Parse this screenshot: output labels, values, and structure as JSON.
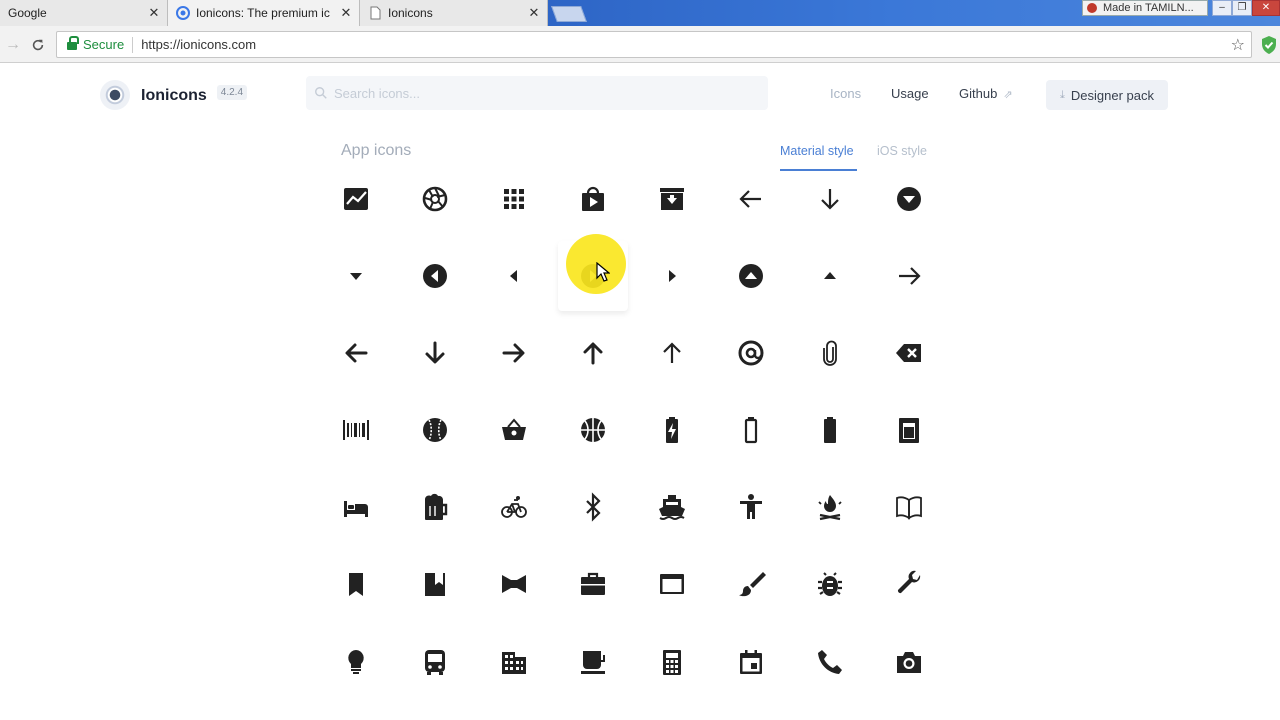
{
  "browser": {
    "tabs": [
      {
        "title": "Google",
        "active": false
      },
      {
        "title": "Ionicons: The premium ic",
        "active": true
      },
      {
        "title": "Ionicons",
        "active": false
      }
    ],
    "window_badge": "Made in TAMILN...",
    "address": {
      "secure_label": "Secure",
      "url": "https://ionicons.com"
    }
  },
  "header": {
    "brand": "Ionicons",
    "version": "4.2.4",
    "search_placeholder": "Search icons...",
    "nav": {
      "icons": "Icons",
      "usage": "Usage",
      "github": "Github",
      "designer_pack": "Designer pack"
    }
  },
  "section": {
    "title": "App icons",
    "style_tabs": {
      "material": "Material style",
      "ios": "iOS style"
    },
    "active_style": "material"
  },
  "icons": [
    "analytics-icon",
    "aperture-icon",
    "apps-icon",
    "appstore-icon",
    "archive-icon",
    "arrow-back-icon",
    "arrow-down-icon",
    "arrow-dropdown-circle-icon",
    "arrow-dropdown-icon",
    "arrow-dropleft-circle-icon",
    "arrow-dropleft-icon",
    "arrow-dropright-circle-icon",
    "arrow-dropright-icon",
    "arrow-dropup-circle-icon",
    "arrow-dropup-icon",
    "arrow-forward-icon",
    "arrow-round-back-icon",
    "arrow-round-down-icon",
    "arrow-round-forward-icon",
    "arrow-round-up-icon",
    "arrow-up-icon",
    "at-icon",
    "attach-icon",
    "backspace-icon",
    "barcode-icon",
    "baseball-icon",
    "basket-icon",
    "basketball-icon",
    "battery-charging-icon",
    "battery-dead-icon",
    "battery-full-icon",
    "beaker-icon",
    "bed-icon",
    "beer-icon",
    "bicycle-icon",
    "bluetooth-icon",
    "boat-icon",
    "body-icon",
    "bonfire-icon",
    "book-icon",
    "bookmark-icon",
    "bookmarks-icon",
    "bowtie-icon",
    "briefcase-icon",
    "browsers-icon",
    "brush-icon",
    "bug-icon",
    "build-icon",
    "bulb-icon",
    "bus-icon",
    "business-icon",
    "cafe-icon",
    "calculator-icon",
    "calendar-icon",
    "call-icon",
    "camera-icon"
  ],
  "hovered_icon": "arrow-dropright-circle-icon",
  "colors": {
    "accent": "#4a7fd4",
    "icon": "#222222",
    "muted": "#a3acb9",
    "secure": "#1e8e3e",
    "highlight": "#fae61e"
  }
}
